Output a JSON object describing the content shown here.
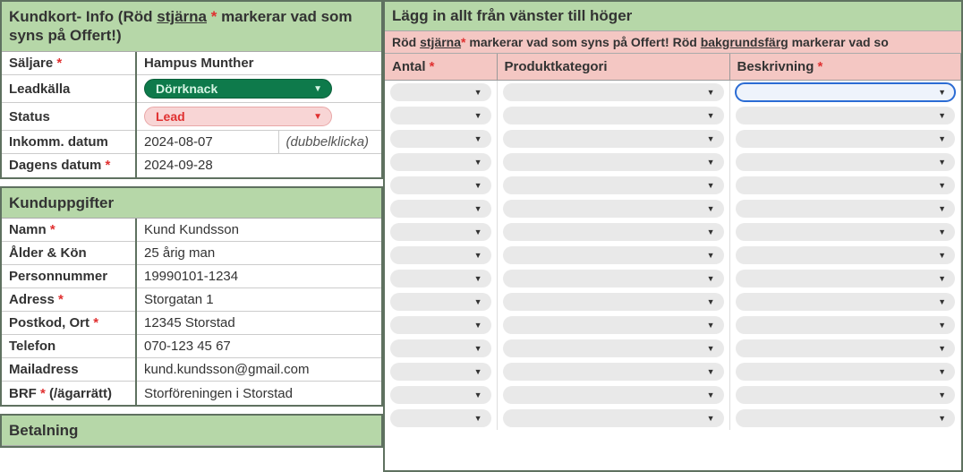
{
  "left": {
    "kundkort": {
      "title_pre": "Kundkort- Info (Röd ",
      "title_underline": "stjärna",
      "title_star": " *",
      "title_post": " markerar vad som syns på Offert!)",
      "saljare_label": "Säljare ",
      "saljare_star": "*",
      "saljare_value": "Hampus Munther",
      "leadkalla_label": "Leadkälla",
      "leadkalla_value": "Dörrknack",
      "status_label": "Status",
      "status_value": "Lead",
      "inkomm_label": "Inkomm. datum",
      "inkomm_value": "2024-08-07",
      "inkomm_hint": "(dubbelklicka)",
      "dagens_label": "Dagens datum ",
      "dagens_star": "*",
      "dagens_value": "2024-09-28"
    },
    "kund": {
      "title": "Kunduppgifter",
      "namn_label": "Namn ",
      "namn_star": "*",
      "namn_value": "Kund Kundsson",
      "alder_label": "Ålder & Kön",
      "alder_value": "25 årig man",
      "pnr_label": "Personnummer",
      "pnr_value": "19990101-1234",
      "adress_label": "Adress ",
      "adress_star": "*",
      "adress_value": "Storgatan 1",
      "postkod_label": "Postkod, Ort ",
      "postkod_star": "*",
      "postkod_value": "12345 Storstad",
      "telefon_label": "Telefon",
      "telefon_value": "070-123 45 67",
      "mail_label": "Mailadress",
      "mail_value": "kund.kundsson@gmail.com",
      "brf_label_pre": "BRF ",
      "brf_star": "*",
      "brf_label_post": " (/ägarrätt)",
      "brf_value": "Storföreningen i Storstad"
    },
    "betalning": {
      "title": "Betalning"
    }
  },
  "right": {
    "header": "Lägg in allt från vänster till höger",
    "sub_pre": "Röd ",
    "sub_u1": "stjärna",
    "sub_star": "*",
    "sub_mid": " markerar vad som syns på Offert! Röd ",
    "sub_u2": "bakgrundsfärg",
    "sub_post": " markerar vad so",
    "col_antal": "Antal ",
    "col_antal_star": "*",
    "col_kat": "Produktkategori",
    "col_besk": "Beskrivning ",
    "col_besk_star": "*",
    "row_count": 15,
    "selected_row": 0,
    "selected_col": 2
  }
}
